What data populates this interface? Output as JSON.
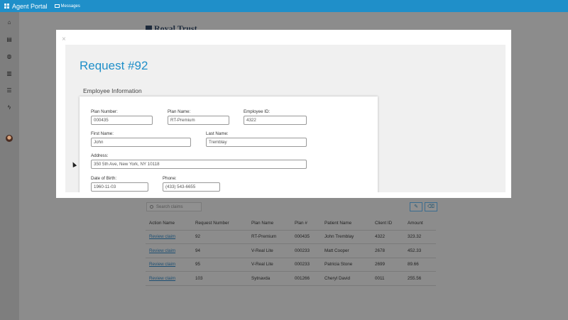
{
  "topbar": {
    "app_title": "Agent Portal",
    "messages_label": "Messages"
  },
  "sidebar": {
    "items": [
      {
        "icon": "home-icon",
        "glyph": "⌂"
      },
      {
        "icon": "document-icon",
        "glyph": "▤"
      },
      {
        "icon": "globe-icon",
        "glyph": "◍"
      },
      {
        "icon": "bar-chart-icon",
        "glyph": "▥"
      },
      {
        "icon": "list-icon",
        "glyph": "☰"
      },
      {
        "icon": "bolt-icon",
        "glyph": "ϟ"
      }
    ]
  },
  "background": {
    "logo_text": "Royal Trust",
    "search_placeholder": "Search claims",
    "table": {
      "headers": [
        "Action Name",
        "Request Number",
        "Plan Name",
        "Plan #",
        "Patient Name",
        "Client ID",
        "Amount"
      ],
      "rows": [
        [
          "Review claim",
          "92",
          "RT-Premium",
          "000435",
          "John Tremblay",
          "4322",
          "323.32"
        ],
        [
          "Review claim",
          "94",
          "V-Real Lite",
          "000233",
          "Matt Cooper",
          "2678",
          "452.33"
        ],
        [
          "Review claim",
          "95",
          "V-Real Lite",
          "000233",
          "Patricia Stone",
          "2699",
          "89.66"
        ],
        [
          "Review claim",
          "103",
          "Sytnavda",
          "001266",
          "Cheryl David",
          "0011",
          "255.56"
        ]
      ]
    }
  },
  "modal": {
    "close_glyph": "×",
    "title": "Request #92",
    "section_title": "Employee Information",
    "fields": {
      "plan_number": {
        "label": "Plan Number:",
        "value": "000435"
      },
      "plan_name": {
        "label": "Plan Name:",
        "value": "RT-Premium"
      },
      "employee_id": {
        "label": "Employee ID:",
        "value": "4322"
      },
      "first_name": {
        "label": "First Name:",
        "value": "John"
      },
      "last_name": {
        "label": "Last Name:",
        "value": "Tremblay"
      },
      "address": {
        "label": "Address:",
        "value": "350 5th Ave, New York, NY 10118"
      },
      "dob": {
        "label": "Date of Birth:",
        "value": "1960-11-03"
      },
      "phone": {
        "label": "Phone:",
        "value": "(433) 543-6655"
      }
    }
  },
  "colors": {
    "accent": "#1f8fc9",
    "overlay": "#8c8c8c"
  }
}
